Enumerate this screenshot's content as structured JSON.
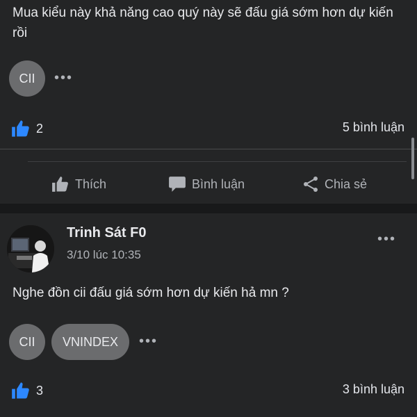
{
  "post1": {
    "text": "Mua kiểu này khả năng cao quý này sẽ đấu giá sớm hơn dự kiến rồi",
    "tags": [
      "CII"
    ],
    "more": "•••",
    "like_count": "2",
    "comment_count": "5 bình luận",
    "actions": {
      "like": "Thích",
      "comment": "Bình luận",
      "share": "Chia sẻ"
    }
  },
  "post2": {
    "author": "Trinh Sát F0",
    "timestamp": "3/10 lúc 10:35",
    "menu": "•••",
    "text": "Nghe đồn cii đấu giá sớm hơn dự kiến hả mn ?",
    "tags": [
      "CII",
      "VNINDEX"
    ],
    "more": "•••",
    "like_count": "3",
    "comment_count": "3 bình luận"
  },
  "colors": {
    "background": "#242526",
    "separator": "#18191a",
    "accent_blue": "#2d88ff",
    "chip": "#6b6c6e",
    "secondary_text": "#b0b3b8"
  },
  "icons": {
    "like": "thumbs-up-icon",
    "comment": "speech-bubble-icon",
    "share": "share-icon",
    "more": "more-dots-icon"
  }
}
